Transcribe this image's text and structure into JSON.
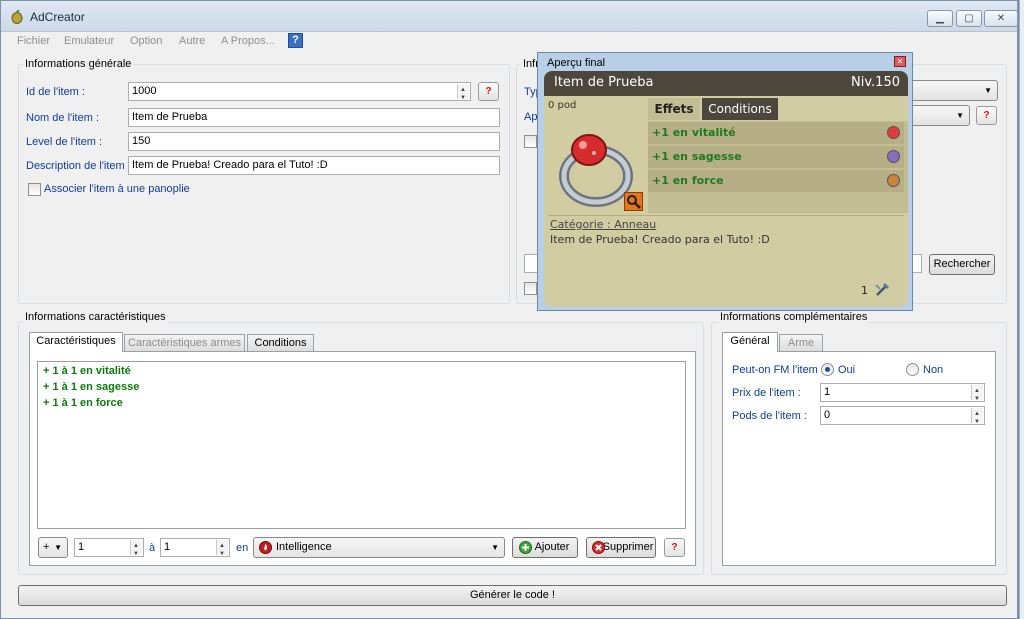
{
  "window": {
    "title": "AdCreator",
    "minimize": "▁",
    "maximize": "▢",
    "close": "✕"
  },
  "menu": {
    "items": [
      "Fichier",
      "Emulateur",
      "Option",
      "Autre",
      "A Propos..."
    ],
    "help": "?"
  },
  "info_generale": {
    "title": "Informations générale",
    "id_label": "Id de l'item :",
    "id_value": "1000",
    "nom_label": "Nom de l'item :",
    "nom_value": "Item de Prueba",
    "level_label": "Level de l'item :",
    "level_value": "150",
    "desc_label": "Description de l'item :",
    "desc_value": "Item de Prueba! Creado para el Tuto! :D",
    "panoplie_label": "Associer l'item à une panoplie",
    "help": "?"
  },
  "info_right": {
    "title_partial": "Infr",
    "type_label": "Typ",
    "app_label": "Ap",
    "rechercher": "Rechercher",
    "help": "?"
  },
  "preview": {
    "title": "Aperçu final",
    "item_name": "Item de Prueba",
    "level": "Niv.150",
    "pod": "0 pod",
    "tabs": [
      "Effets",
      "Conditions"
    ],
    "effects": [
      {
        "text": "+1 en vitalité",
        "icon": "vitality-icon",
        "color": "#e23b3b"
      },
      {
        "text": "+1 en sagesse",
        "icon": "wisdom-icon",
        "color": "#8a6bbd"
      },
      {
        "text": "+1 en force",
        "icon": "strength-icon",
        "color": "#c8843a"
      }
    ],
    "category": "Catégorie : Anneau",
    "description": "Item de Prueba! Creado para el Tuto! :D",
    "quantity": "1"
  },
  "caracteristiques": {
    "title": "Informations caractéristiques",
    "tabs": [
      "Caractéristiques",
      "Caractéristiques armes",
      "Conditions"
    ],
    "lines": [
      "+ 1 à 1 en vitalité",
      "+ 1 à 1 en sagesse",
      "+ 1 à 1 en force"
    ],
    "sign": "+",
    "min_value": "1",
    "a_label": "à",
    "max_value": "1",
    "en_label": "en",
    "stat_select": "Intelligence",
    "add_label": "Ajouter",
    "delete_label": "Supprimer",
    "help": "?"
  },
  "complementaires": {
    "title": "Informations complémentaires",
    "tabs": [
      "Général",
      "Arme"
    ],
    "fm_label": "Peut-on FM l'item :",
    "fm_oui": "Oui",
    "fm_non": "Non",
    "prix_label": "Prix de l'item :",
    "prix_value": "1",
    "pods_label": "Pods de l'item :",
    "pods_value": "0"
  },
  "generate_label": "Générer le code !",
  "colors": {
    "label_blue": "#0c3e9b",
    "stat_green": "#0c7a0c",
    "card_bg": "#d2cca3",
    "card_header": "#4d463c"
  }
}
